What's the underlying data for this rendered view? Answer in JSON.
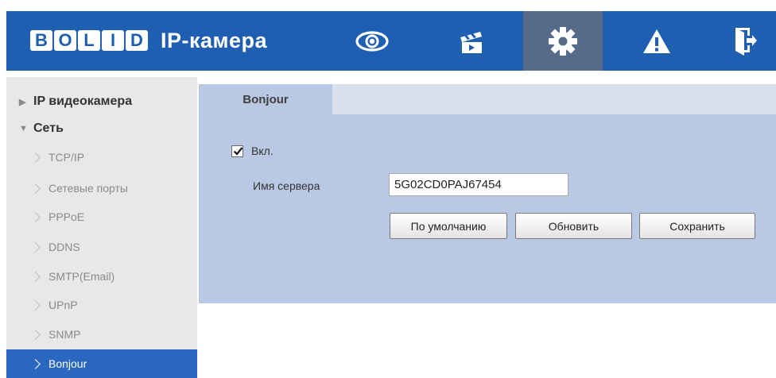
{
  "header": {
    "logo_letters": [
      "B",
      "O",
      "L",
      "I",
      "D"
    ],
    "title": "IP-камера",
    "nav_icons": [
      "eye-icon",
      "clapperboard-icon",
      "gear-icon",
      "warning-icon",
      "logout-icon"
    ],
    "active_nav": "gear-icon",
    "colors": {
      "bar": "#1f5fb1",
      "active": "#566b8a"
    }
  },
  "sidebar": {
    "items": [
      {
        "label": "IP видеокамера",
        "level": "top",
        "expanded": false
      },
      {
        "label": "Сеть",
        "level": "top",
        "expanded": true
      },
      {
        "label": "TCP/IP",
        "level": "sub"
      },
      {
        "label": "Сетевые порты",
        "level": "sub"
      },
      {
        "label": "PPPoE",
        "level": "sub"
      },
      {
        "label": "DDNS",
        "level": "sub"
      },
      {
        "label": "SMTP(Email)",
        "level": "sub"
      },
      {
        "label": "UPnP",
        "level": "sub"
      },
      {
        "label": "SNMP",
        "level": "sub"
      },
      {
        "label": "Bonjour",
        "level": "sub",
        "selected": true
      }
    ]
  },
  "main": {
    "tab_label": "Bonjour",
    "enable_label": "Вкл.",
    "enable_checked": true,
    "server_name_label": "Имя сервера",
    "server_name_value": "5G02CD0PAJ67454",
    "buttons": {
      "default_label": "По умолчанию",
      "refresh_label": "Обновить",
      "save_label": "Сохранить"
    }
  }
}
